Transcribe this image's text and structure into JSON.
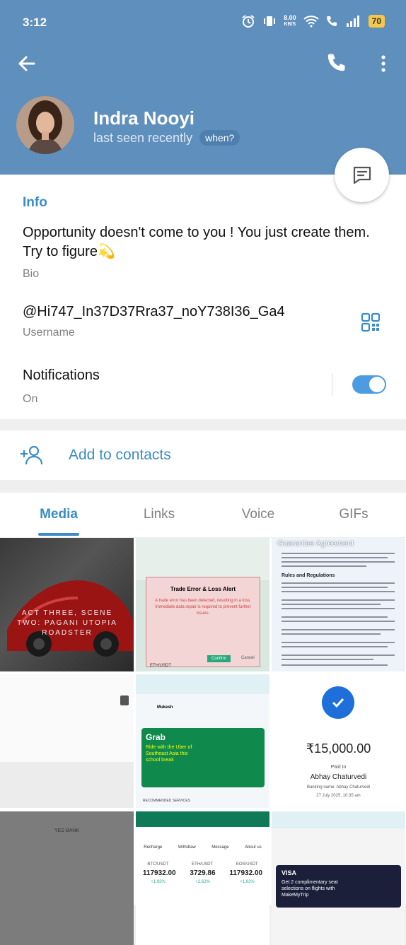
{
  "status_bar": {
    "time": "3:12",
    "net_speed_value": "8.00",
    "net_speed_unit": "KB/S",
    "battery": "70"
  },
  "profile": {
    "name": "Indra Nooyi",
    "last_seen": "last seen recently",
    "when_pill": "when?"
  },
  "info": {
    "section_title": "Info",
    "bio_text": "Opportunity doesn't come to you ! You just create them. Try to figure💫",
    "bio_label": "Bio",
    "username_text": "@Hi747_In37D37Rra37_noY738I36_Ga4",
    "username_label": "Username",
    "notifications_text": "Notifications",
    "notifications_state": "On",
    "notifications_enabled": true
  },
  "actions": {
    "add_to_contacts": "Add to contacts"
  },
  "tabs": [
    {
      "label": "Media",
      "active": true
    },
    {
      "label": "Links",
      "active": false
    },
    {
      "label": "Voice",
      "active": false
    },
    {
      "label": "GIFs",
      "active": false
    }
  ],
  "media": {
    "c1_text": "ACT THREE, SCENE TWO: PAGANI UTOPIA ROADSTER",
    "c2_title": "Trade Error & Loss Alert",
    "c2_body": "A trade error has been detected, resulting in a loss. Immediate data repair is required to prevent further issues.",
    "c2_confirm": "Confirm",
    "c2_cancel": "Cancel",
    "c2_ticker": "ETH/USDT",
    "c3_title": "Guarantee Agreement",
    "c3_heading": "Rules and Regulations",
    "c5_sender": "Mukesh",
    "c5_brand": "Grab",
    "c5_promo": "Ride with the Uber of Southeast Asia this school break",
    "c5_footer": "RECOMMENDED SERVICES",
    "c6_amount": "₹15,000.00",
    "c6_paid_to": "Paid to",
    "c6_payee": "Abhay Chaturvedi",
    "c6_bank": "Banking name: Abhay Chaturvedi",
    "c6_date": "27 July 2025, 10:35 am",
    "c7_text": "YES BANK",
    "c8_menu": [
      "Recharge",
      "Withdraw",
      "Message",
      "About us"
    ],
    "c8_pairs": [
      "BTC/USDT",
      "ETH/USDT",
      "EOS/USDT"
    ],
    "c8_prices": [
      "117932.00",
      "3729.86",
      "117932.00"
    ],
    "c8_changes": [
      "+1.92%",
      "+2.62%",
      "+1.92%"
    ],
    "c9_brand": "VISA",
    "c9_promo": "Get 2 complimentary seat selections on flights with MakeMyTrip"
  },
  "colors": {
    "header": "#5f8fbd",
    "accent": "#3b8cc6",
    "toggle": "#4d9be0"
  }
}
